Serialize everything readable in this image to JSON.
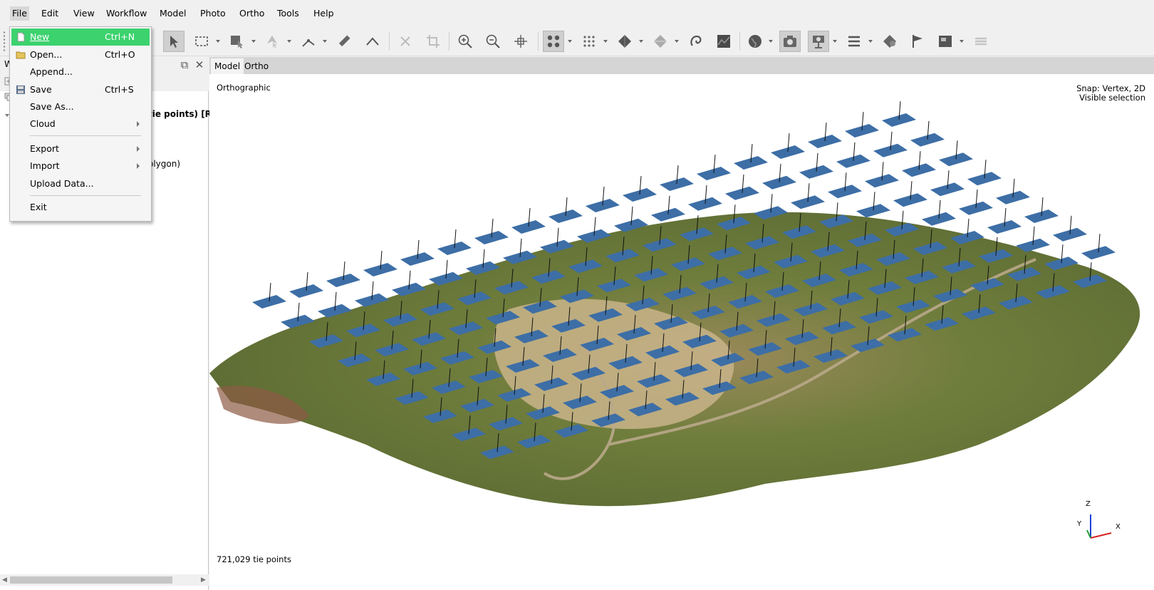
{
  "menubar": {
    "items": [
      {
        "label": "File",
        "active": true
      },
      {
        "label": "Edit"
      },
      {
        "label": "View"
      },
      {
        "label": "Workflow"
      },
      {
        "label": "Model"
      },
      {
        "label": "Photo"
      },
      {
        "label": "Ortho"
      },
      {
        "label": "Tools"
      },
      {
        "label": "Help"
      }
    ]
  },
  "file_menu": {
    "items": [
      {
        "label": "New",
        "shortcut": "Ctrl+N",
        "icon": "new-document-icon",
        "highlighted": true
      },
      {
        "label": "Open...",
        "shortcut": "Ctrl+O",
        "icon": "open-folder-icon"
      },
      {
        "label": "Append...",
        "shortcut": ""
      },
      {
        "label": "Save",
        "shortcut": "Ctrl+S",
        "icon": "save-disk-icon"
      },
      {
        "label": "Save As...",
        "shortcut": ""
      },
      {
        "label": "Cloud",
        "submenu": true
      },
      {
        "label": "Export",
        "submenu": true
      },
      {
        "label": "Import",
        "submenu": true
      },
      {
        "label": "Upload Data...",
        "shortcut": ""
      },
      {
        "label": "Exit",
        "shortcut": ""
      }
    ]
  },
  "toolbar": {
    "icons": [
      "select-arrow-icon",
      "rectangle-selection-icon",
      "free-form-selection-icon",
      "circle-selection-icon",
      "ruler-icon",
      "measure-angle-icon",
      "delete-selection-icon",
      "crop-icon",
      "zoom-in-icon",
      "zoom-out-icon",
      "move-object-icon",
      "point-cloud-icon",
      "dense-cloud-icon",
      "mesh-solid-icon",
      "mesh-textured-icon",
      "tiled-model-icon",
      "dem-icon",
      "globe-icon",
      "camera-icon",
      "camera-position-icon",
      "list-icon",
      "markers-icon",
      "flag-icon",
      "image-icon",
      "layers-icon"
    ]
  },
  "left_pane": {
    "title": "W",
    "tree_line_1": "tie points) [R]",
    "tree_line_2": "olygon)"
  },
  "view_tabs": [
    {
      "label": "Model",
      "active": true
    },
    {
      "label": "Ortho"
    }
  ],
  "viewport": {
    "projection": "Orthographic",
    "snap_line1": "Snap: Vertex, 2D",
    "snap_line2": "Visible selection",
    "status": "721,029 tie points",
    "axes": {
      "z": "Z",
      "y": "Y",
      "x": "X"
    },
    "camera_color": "#3d6ea6",
    "terrain_color": "#6e7f3a"
  },
  "colors": {
    "menu_highlight": "#3cd26e",
    "toolbar_bg": "#f0f0f0"
  }
}
